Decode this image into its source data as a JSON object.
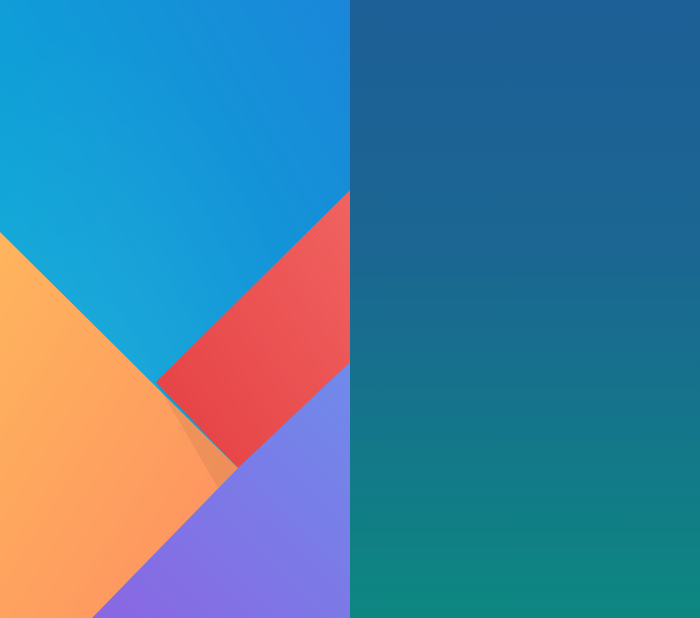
{
  "wallpapers": [
    {
      "style": "geometric",
      "colors": {
        "sky_top_right": "#1a86d9",
        "sky_bottom_left": "#05b4d6",
        "orange_light": "#ffb55d",
        "orange_dark": "#fd8f61",
        "red_light": "#f06360",
        "red_dark": "#e53f43",
        "blue_violet": "#6f8bea",
        "violet": "#8a66e3"
      }
    },
    {
      "style": "gradient",
      "colors": {
        "top": "#1d5f97",
        "bottom": "#0d8781"
      }
    }
  ]
}
